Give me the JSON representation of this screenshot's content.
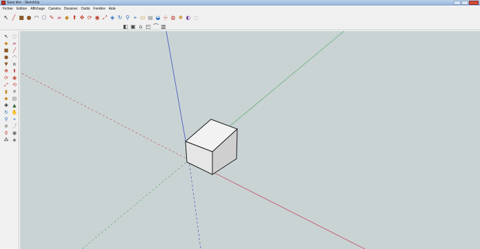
{
  "window": {
    "title": "Sans titre - SketchUp"
  },
  "menubar": {
    "items": [
      {
        "name": "menu-fichier",
        "label": "Fichier"
      },
      {
        "name": "menu-edition",
        "label": "Edition"
      },
      {
        "name": "menu-affichage",
        "label": "Affichage"
      },
      {
        "name": "menu-camera",
        "label": "Caméra"
      },
      {
        "name": "menu-dessiner",
        "label": "Dessiner"
      },
      {
        "name": "menu-outils",
        "label": "Outils"
      },
      {
        "name": "menu-fenetre",
        "label": "Fenêtre"
      },
      {
        "name": "menu-aide",
        "label": "Aide"
      }
    ]
  },
  "toolbar_main": {
    "buttons": [
      {
        "name": "select-tool-icon",
        "glyph": "↖",
        "color": "#222222"
      },
      {
        "name": "line-tool-icon",
        "glyph": "╱",
        "color": "#c0392b"
      },
      {
        "name": "rectangle-tool-icon",
        "glyph": "■",
        "color": "#8b5a2b"
      },
      {
        "name": "circle-tool-icon",
        "glyph": "●",
        "color": "#8b5a2b"
      },
      {
        "name": "arc-tool-icon",
        "glyph": "◠",
        "color": "#555555"
      },
      {
        "name": "polygon-tool-icon",
        "glyph": "⬠",
        "color": "#7a7aa0"
      },
      {
        "name": "freehand-tool-icon",
        "glyph": "✎",
        "color": "#c0392b"
      },
      {
        "name": "eraser-tool-icon",
        "glyph": "▰",
        "color": "#d48aa0"
      },
      {
        "name": "paint-bucket-icon",
        "glyph": "◆",
        "color": "#c98a2a"
      },
      {
        "name": "push-pull-icon",
        "glyph": "⬆",
        "color": "#c0392b"
      },
      {
        "name": "move-tool-icon",
        "glyph": "✥",
        "color": "#c0392b"
      },
      {
        "name": "rotate-tool-icon",
        "glyph": "⟳",
        "color": "#c0392b"
      },
      {
        "name": "follow-me-icon",
        "glyph": "◉",
        "color": "#c0392b"
      },
      {
        "name": "scale-tool-icon",
        "glyph": "⤢",
        "color": "#c0392b"
      },
      {
        "name": "offset-tool-icon",
        "glyph": "◈",
        "color": "#2a6fc0"
      },
      {
        "name": "orbit-tool-icon",
        "glyph": "↻",
        "color": "#2a6fc0"
      },
      {
        "name": "zoom-tool-icon",
        "glyph": "⚲",
        "color": "#2a6fc0"
      },
      {
        "name": "zoom-extents-icon",
        "glyph": "⌖",
        "color": "#2a6fc0"
      },
      {
        "name": "tape-measure-icon",
        "glyph": "▭",
        "color": "#c98a2a"
      },
      {
        "name": "dimension-tool-icon",
        "glyph": "▤",
        "color": "#888888"
      },
      {
        "name": "protractor-icon",
        "glyph": "◒",
        "color": "#2a6fc0"
      },
      {
        "name": "axes-tool-icon",
        "glyph": "⊹",
        "color": "#c0392b"
      },
      {
        "name": "text-tool-icon",
        "glyph": "◍",
        "color": "#c0392b"
      },
      {
        "name": "3d-text-icon",
        "glyph": "❖",
        "color": "#c98a2a"
      },
      {
        "name": "components-icon",
        "glyph": "◐",
        "color": "#7a4aa0"
      },
      {
        "name": "extension-warehouse-icon",
        "glyph": "◌",
        "color": "#999999"
      }
    ]
  },
  "toolbar_secondary": {
    "buttons": [
      {
        "name": "view-iso-icon",
        "glyph": "◧",
        "color": "#444444"
      },
      {
        "name": "view-top-icon",
        "glyph": "▣",
        "color": "#444444"
      },
      {
        "name": "view-front-icon",
        "glyph": "⌂",
        "color": "#444444"
      },
      {
        "name": "view-right-icon",
        "glyph": "◰",
        "color": "#444444"
      },
      {
        "name": "view-back-icon",
        "glyph": "⌒",
        "color": "#444444"
      },
      {
        "name": "view-left-icon",
        "glyph": "▥",
        "color": "#444444"
      }
    ]
  },
  "toolbar_left": {
    "buttons": [
      {
        "name": "select-icon",
        "glyph": "↖",
        "color": "#222222"
      },
      {
        "name": "make-component-icon",
        "glyph": "◌",
        "color": "#777777"
      },
      {
        "name": "paint-icon",
        "glyph": "◆",
        "color": "#c98a2a"
      },
      {
        "name": "eraser-icon",
        "glyph": "▰",
        "color": "#d48aa0"
      },
      {
        "name": "rectangle-icon",
        "glyph": "■",
        "color": "#8b5a2b"
      },
      {
        "name": "line-icon",
        "glyph": "╱",
        "color": "#c0392b"
      },
      {
        "name": "circle-icon",
        "glyph": "●",
        "color": "#8b5a2b"
      },
      {
        "name": "arc-icon",
        "glyph": "◠",
        "color": "#555555"
      },
      {
        "name": "polygon-icon",
        "glyph": "▼",
        "color": "#8b5a2b"
      },
      {
        "name": "freehand-icon",
        "glyph": "ຣ",
        "color": "#555555"
      },
      {
        "name": "move-icon",
        "glyph": "✥",
        "color": "#c0392b"
      },
      {
        "name": "push-pull-icon-left",
        "glyph": "⬆",
        "color": "#c0392b"
      },
      {
        "name": "rotate-icon",
        "glyph": "⟳",
        "color": "#c0392b"
      },
      {
        "name": "follow-me-icon-left",
        "glyph": "◉",
        "color": "#c0392b"
      },
      {
        "name": "scale-icon",
        "glyph": "⤢",
        "color": "#c0392b"
      },
      {
        "name": "offset-icon",
        "glyph": "⟲",
        "color": "#c0392b"
      },
      {
        "name": "tape-measure-icon-left",
        "glyph": "▮",
        "color": "#c98a2a"
      },
      {
        "name": "dimension-icon",
        "glyph": "✕",
        "color": "#555555"
      },
      {
        "name": "protractor-icon-left",
        "glyph": "◆",
        "color": "#c98a2a"
      },
      {
        "name": "text-icon",
        "glyph": "▤",
        "color": "#777777"
      },
      {
        "name": "axes-icon",
        "glyph": "✚",
        "color": "#333333"
      },
      {
        "name": "3d-text-icon-left",
        "glyph": "▲",
        "color": "#3a6a3a"
      },
      {
        "name": "orbit-icon",
        "glyph": "↻",
        "color": "#2a6fc0"
      },
      {
        "name": "pan-icon",
        "glyph": "✋",
        "color": "#777777"
      },
      {
        "name": "zoom-icon",
        "glyph": "⚲",
        "color": "#2a6fc0"
      },
      {
        "name": "zoom-window-icon",
        "glyph": "⌖",
        "color": "#2a6fc0"
      },
      {
        "name": "zoom-extents-icon-left",
        "glyph": "⊕",
        "color": "#777777"
      },
      {
        "name": "previous-view-icon",
        "glyph": "⤴",
        "color": "#aaaaaa"
      },
      {
        "name": "position-camera-icon",
        "glyph": "♀",
        "color": "#c0392b"
      },
      {
        "name": "look-around-icon",
        "glyph": "◉",
        "color": "#555555"
      },
      {
        "name": "walk-icon",
        "glyph": "⁂",
        "color": "#333333"
      },
      {
        "name": "section-plane-icon",
        "glyph": "◈",
        "color": "#555555"
      }
    ]
  },
  "viewport": {
    "background": "#c9d3d3",
    "axis_colors": {
      "red": "#c4556a",
      "green": "#5fa86f",
      "blue": "#3e4fc0"
    },
    "cube_colors": {
      "top": "#f2f2f2",
      "left": "#e6e6e6",
      "right": "#cfcfcf",
      "edge": "#1a1a1a"
    }
  }
}
